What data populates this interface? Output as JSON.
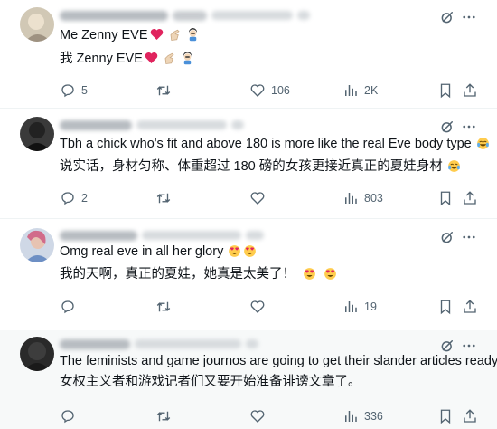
{
  "posts": [
    {
      "lines": [
        "Me Zenny EVE",
        "我 Zenny EVE"
      ],
      "replies": "5",
      "reposts": "",
      "likes": "106",
      "views": "2K"
    },
    {
      "lines": [
        "Tbh a chick who's fit and above 180 is more like the real Eve body type",
        "说实话，身材匀称、体重超过 180 磅的女孩更接近真正的夏娃身材"
      ],
      "replies": "2",
      "reposts": "",
      "likes": "",
      "views": "803"
    },
    {
      "lines": [
        "Omg real eve in all her glory",
        "我的天啊，真正的夏娃，她真是太美了！"
      ],
      "replies": "",
      "reposts": "",
      "likes": "",
      "views": "19"
    },
    {
      "lines": [
        "The feminists and game journos are going to get their slander articles ready",
        "女权主义者和游戏记者们又要开始准备诽谤文章了。"
      ],
      "replies": "",
      "reposts": "",
      "likes": "",
      "views": "336"
    }
  ],
  "colors": {
    "text": "#0f1419",
    "secondary": "#536471",
    "divider": "#eff3f4",
    "shaded_bg": "#f7f9f9",
    "heart": "#e0245e"
  },
  "icons": [
    "reply-icon",
    "repost-icon",
    "like-icon",
    "views-icon",
    "bookmark-icon",
    "share-icon",
    "grok-icon",
    "more-icon"
  ]
}
